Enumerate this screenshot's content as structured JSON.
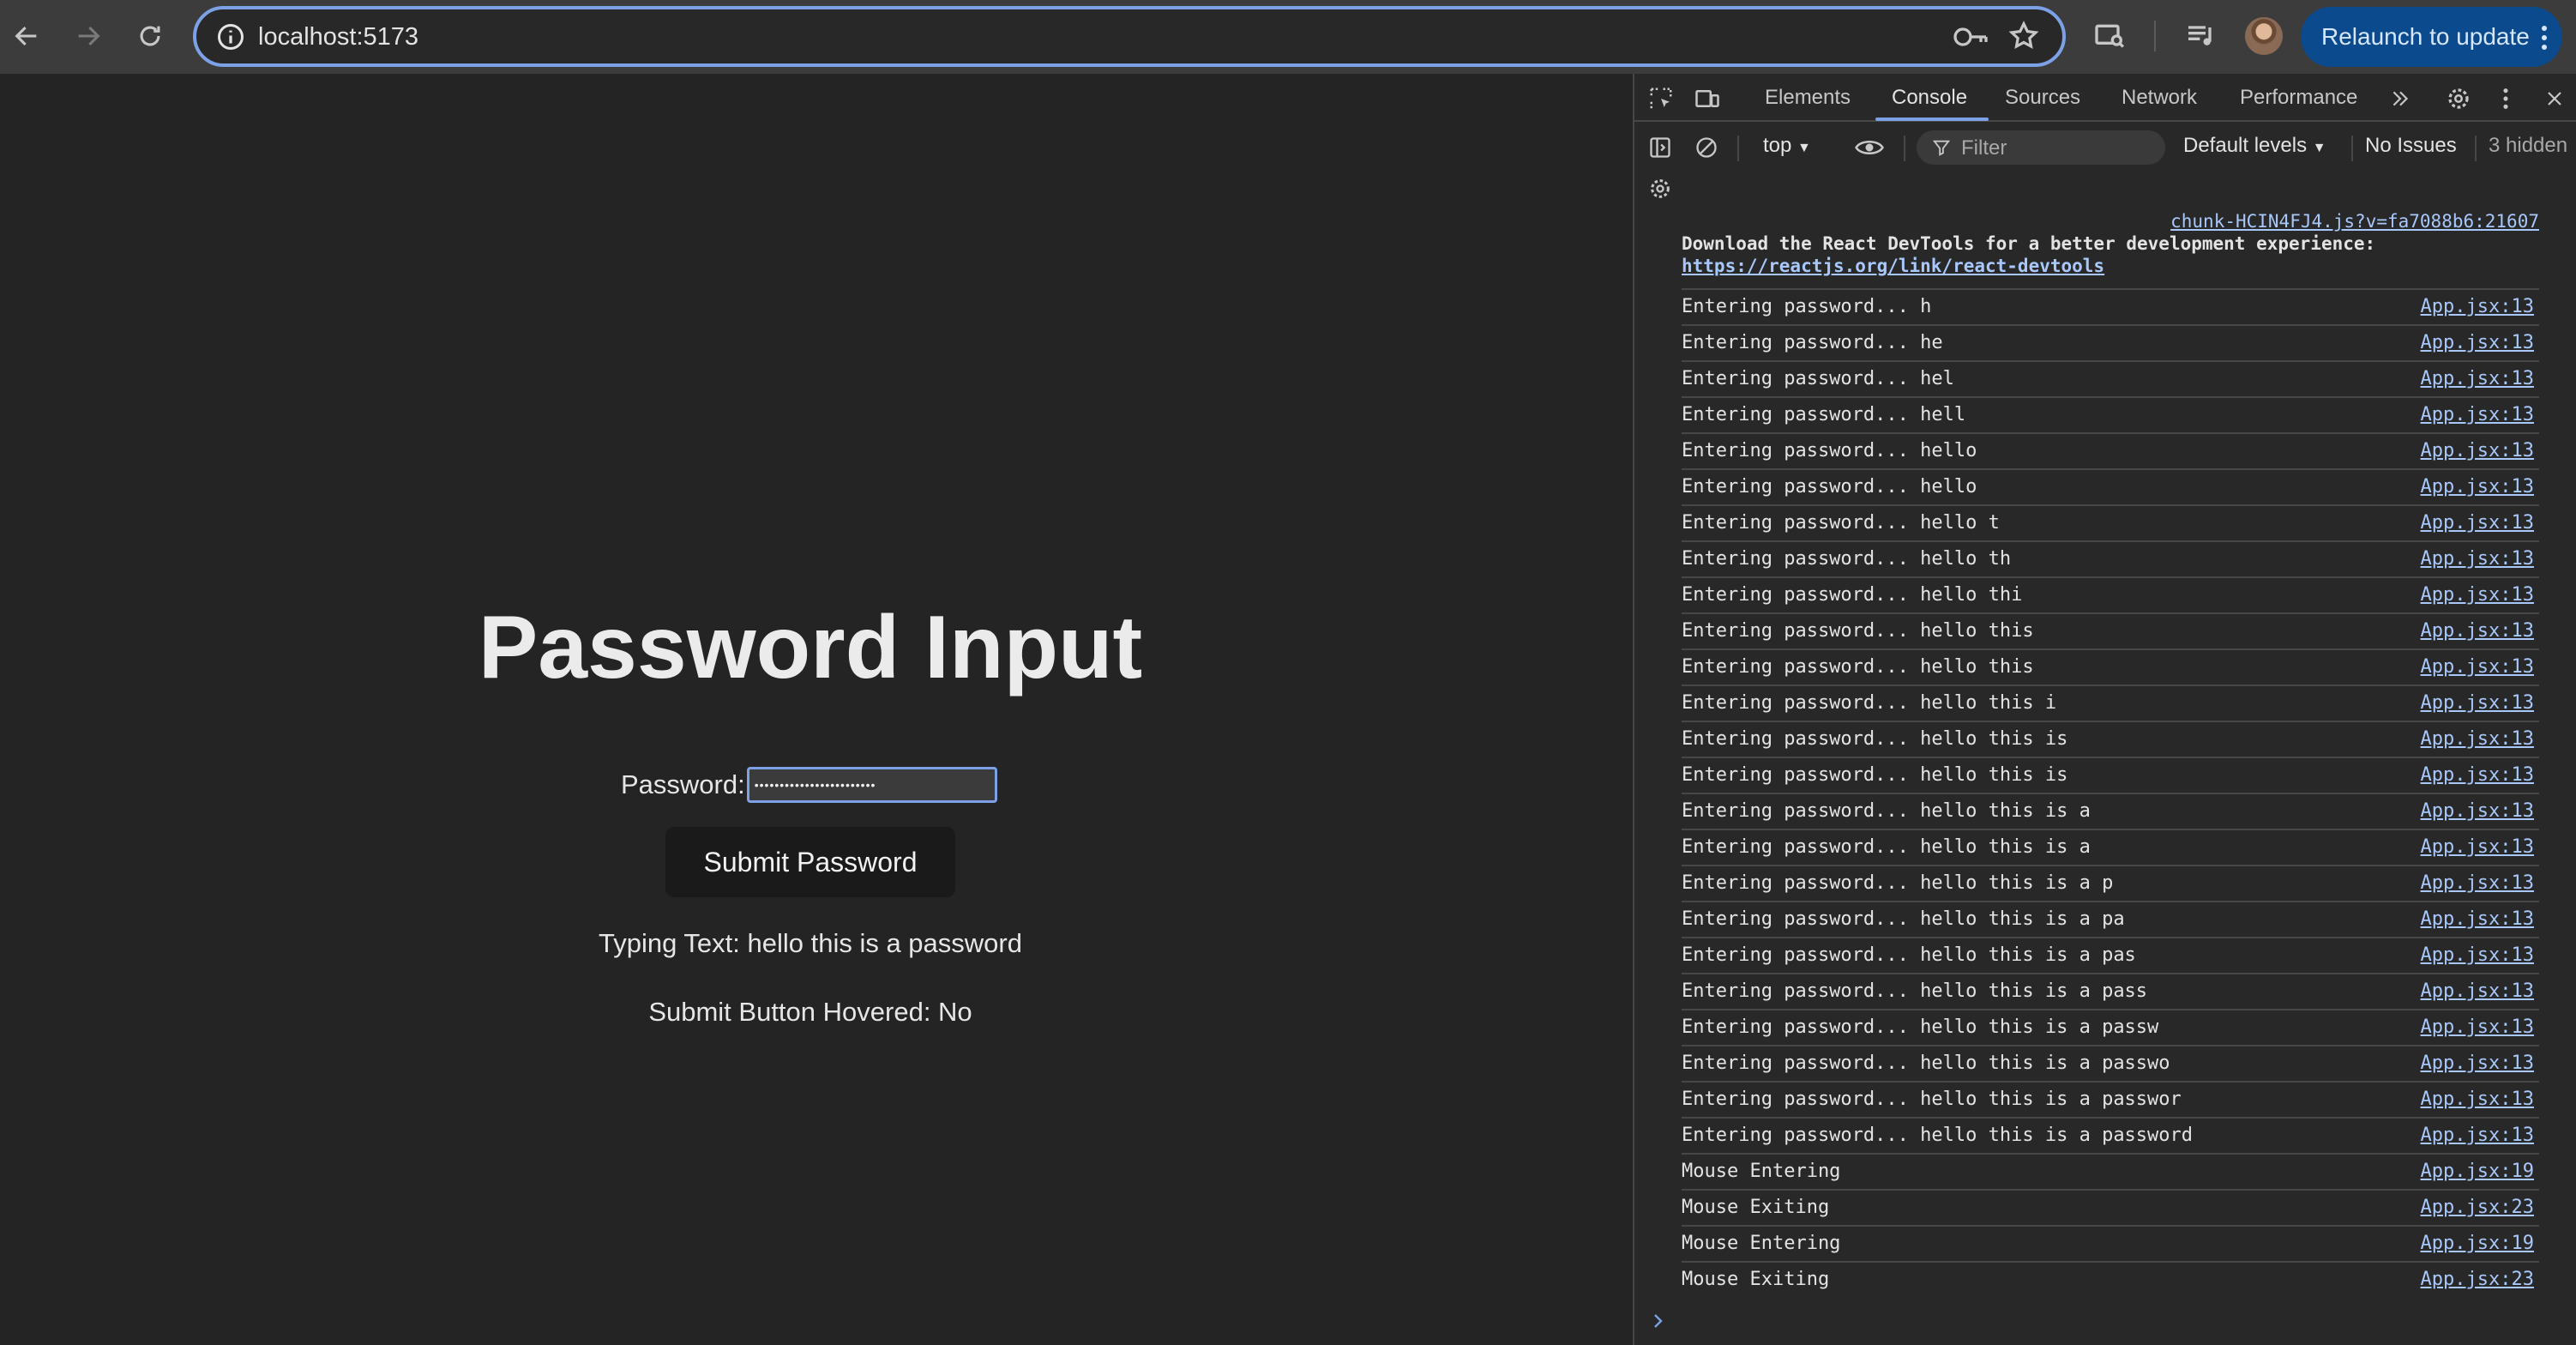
{
  "browser": {
    "url": "localhost:5173",
    "relaunch_label": "Relaunch to update"
  },
  "page": {
    "title": "Password Input",
    "password_label": "Password:",
    "password_value": "••••••••••••••••••••••••",
    "submit_label": "Submit Password",
    "typing_text": "Typing Text: hello this is a password",
    "hover_text": "Submit Button Hovered: No"
  },
  "devtools": {
    "tabs": [
      "Elements",
      "Console",
      "Sources",
      "Network",
      "Performance"
    ],
    "active_tab": "Console",
    "context": "top",
    "filter_placeholder": "Filter",
    "levels": "Default levels",
    "issues": "No Issues",
    "hidden_count": "3 hidden",
    "react_message": {
      "source": "chunk-HCIN4FJ4.js?v=fa7088b6:21607",
      "line1": "Download the React DevTools for a better development experience:",
      "link": "https://reactjs.org/link/react-devtools"
    },
    "logs": [
      {
        "msg": "Entering password... h",
        "src": "App.jsx:13"
      },
      {
        "msg": "Entering password... he",
        "src": "App.jsx:13"
      },
      {
        "msg": "Entering password... hel",
        "src": "App.jsx:13"
      },
      {
        "msg": "Entering password... hell",
        "src": "App.jsx:13"
      },
      {
        "msg": "Entering password... hello",
        "src": "App.jsx:13"
      },
      {
        "msg": "Entering password... hello",
        "src": "App.jsx:13"
      },
      {
        "msg": "Entering password... hello t",
        "src": "App.jsx:13"
      },
      {
        "msg": "Entering password... hello th",
        "src": "App.jsx:13"
      },
      {
        "msg": "Entering password... hello thi",
        "src": "App.jsx:13"
      },
      {
        "msg": "Entering password... hello this",
        "src": "App.jsx:13"
      },
      {
        "msg": "Entering password... hello this",
        "src": "App.jsx:13"
      },
      {
        "msg": "Entering password... hello this i",
        "src": "App.jsx:13"
      },
      {
        "msg": "Entering password... hello this is",
        "src": "App.jsx:13"
      },
      {
        "msg": "Entering password... hello this is",
        "src": "App.jsx:13"
      },
      {
        "msg": "Entering password... hello this is a",
        "src": "App.jsx:13"
      },
      {
        "msg": "Entering password... hello this is a",
        "src": "App.jsx:13"
      },
      {
        "msg": "Entering password... hello this is a p",
        "src": "App.jsx:13"
      },
      {
        "msg": "Entering password... hello this is a pa",
        "src": "App.jsx:13"
      },
      {
        "msg": "Entering password... hello this is a pas",
        "src": "App.jsx:13"
      },
      {
        "msg": "Entering password... hello this is a pass",
        "src": "App.jsx:13"
      },
      {
        "msg": "Entering password... hello this is a passw",
        "src": "App.jsx:13"
      },
      {
        "msg": "Entering password... hello this is a passwo",
        "src": "App.jsx:13"
      },
      {
        "msg": "Entering password... hello this is a passwor",
        "src": "App.jsx:13"
      },
      {
        "msg": "Entering password... hello this is a password",
        "src": "App.jsx:13"
      },
      {
        "msg": "Mouse Entering",
        "src": "App.jsx:19"
      },
      {
        "msg": "Mouse Exiting",
        "src": "App.jsx:23"
      },
      {
        "msg": "Mouse Entering",
        "src": "App.jsx:19"
      },
      {
        "msg": "Mouse Exiting",
        "src": "App.jsx:23"
      }
    ]
  }
}
